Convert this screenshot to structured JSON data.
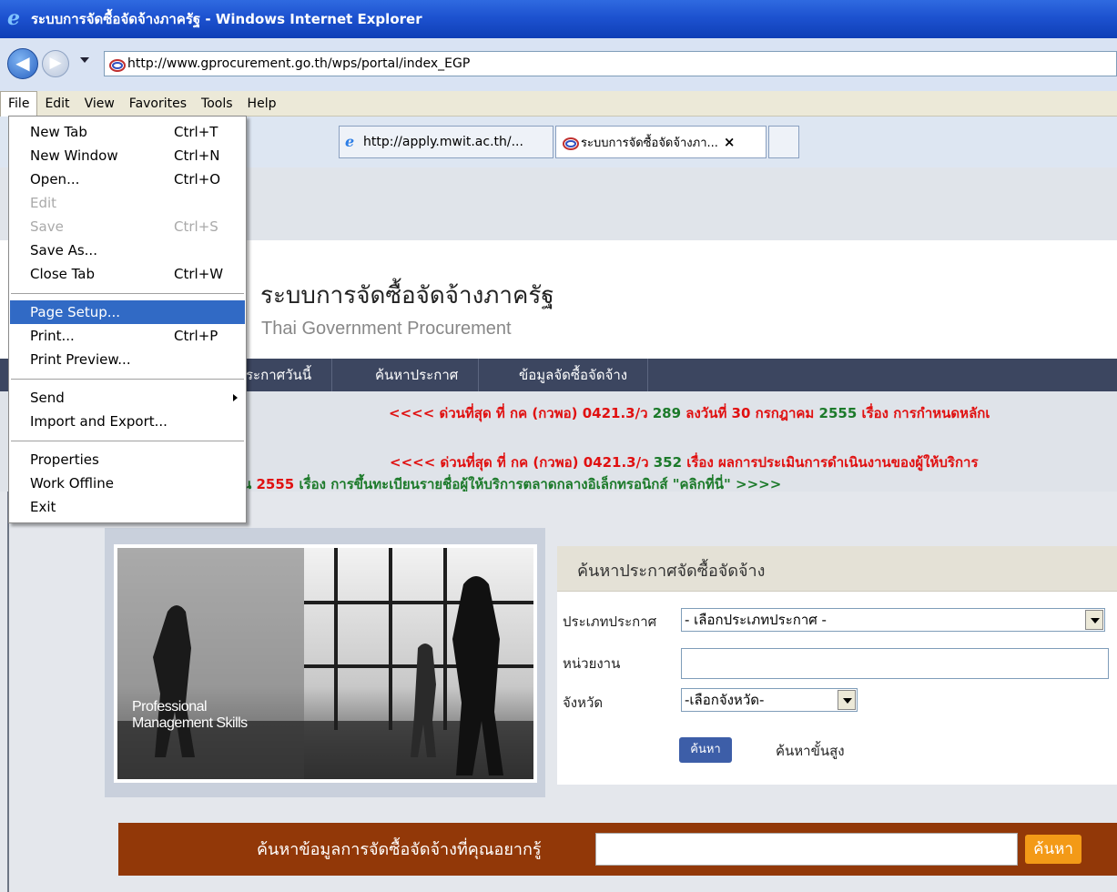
{
  "window": {
    "title": "ระบบการจัดซื้อจัดจ้างภาครัฐ - Windows Internet Explorer"
  },
  "address": {
    "url": "http://www.gprocurement.go.th/wps/portal/index_EGP"
  },
  "menubar": [
    "File",
    "Edit",
    "View",
    "Favorites",
    "Tools",
    "Help"
  ],
  "tabs": [
    {
      "label": "http://apply.mwit.ac.th/..."
    },
    {
      "label": "ระบบการจัดซื้อจัดจ้างภา...",
      "close": "×"
    }
  ],
  "file_menu": {
    "items": [
      {
        "label": "New Tab",
        "shortcut": "Ctrl+T"
      },
      {
        "label": "New Window",
        "shortcut": "Ctrl+N"
      },
      {
        "label": "Open...",
        "shortcut": "Ctrl+O"
      },
      {
        "label": "Edit",
        "shortcut": ""
      },
      {
        "label": "Save",
        "shortcut": "Ctrl+S"
      },
      {
        "label": "Save As...",
        "shortcut": ""
      },
      {
        "label": "Close Tab",
        "shortcut": "Ctrl+W"
      },
      {
        "label": "Page Setup...",
        "shortcut": ""
      },
      {
        "label": "Print...",
        "shortcut": "Ctrl+P"
      },
      {
        "label": "Print Preview...",
        "shortcut": ""
      },
      {
        "label": "Send",
        "shortcut": ""
      },
      {
        "label": "Import and Export...",
        "shortcut": ""
      },
      {
        "label": "Properties",
        "shortcut": ""
      },
      {
        "label": "Work Offline",
        "shortcut": ""
      },
      {
        "label": "Exit",
        "shortcut": ""
      }
    ]
  },
  "site": {
    "title_th": "ระบบการจัดซื้อจัดจ้างภาครัฐ",
    "title_en": "Thai Government Procurement",
    "nav": [
      "ประกาศวันนี้",
      "ค้นหาประกาศ",
      "ข้อมูลจัดซื้อจัดจ้าง"
    ],
    "nav_first_visible": "ระกาศวันนี้"
  },
  "news": {
    "line1": {
      "prefix": "<<<< ด่วนที่สุด ที่ กค (กวพอ) 0421.3/ว ",
      "num": "289",
      "mid": " ลงวันที่ 30 กรกฎาคม ",
      "year": "2555",
      "rest": " เรื่อง การกำหนดหลักเ"
    },
    "line2": {
      "prefix": "<<<< ด่วนที่สุด ที่ กค (กวพอ) 0421.3/ว ",
      "num": "352",
      "rest": " เรื่อง ผลการประเมินการดำเนินงานของผู้ให้บริการ"
    },
    "line3": {
      "prefix": "น ",
      "year": "2555",
      "rest": " เรื่อง การขึ้นทะเบียนรายชื่อผู้ให้บริการตลาดกลางอิเล็กทรอนิกส์ \"คลิกที่นี่\" >>>>"
    }
  },
  "banner": {
    "caption_line1": "Professional",
    "caption_line2": "Management Skills"
  },
  "search": {
    "panel_title": "ค้นหาประกาศจัดซื้อจัดจ้าง",
    "type_label": "ประเภทประกาศ",
    "type_value": "- เลือกประเภทประกาศ -",
    "agency_label": "หน่วยงาน",
    "agency_value": "",
    "province_label": "จังหวัด",
    "province_value": "-เลือกจังหวัด-",
    "search_button": "ค้นหา",
    "advanced_link": "ค้นหาขั้นสูง"
  },
  "bottom_search": {
    "label": "ค้นหาข้อมูลการจัดซื้อจัดจ้างที่คุณอยากรู้",
    "value": "",
    "button": "ค้นหา"
  }
}
